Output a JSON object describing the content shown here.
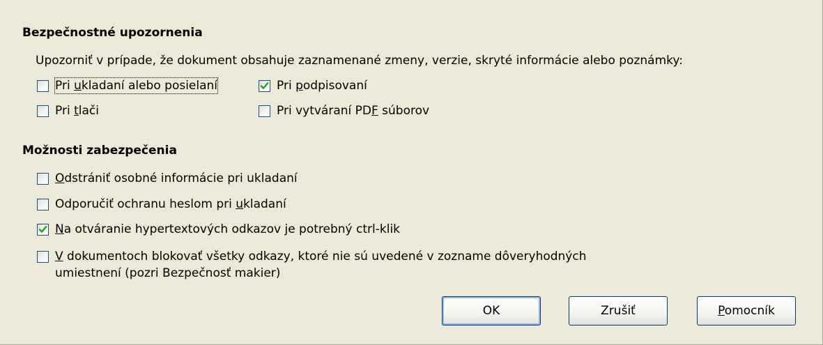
{
  "security_warnings": {
    "title": "Bezpečnostné upozornenia",
    "description": "Upozorniť v prípade, že dokument obsahuje zaznamenané zmeny, verzie, skryté informácie alebo poznámky:",
    "options": [
      {
        "pre": "Pri ",
        "key": "u",
        "post": "kladaní alebo posielaní",
        "checked": false
      },
      {
        "pre": "Pri ",
        "key": "p",
        "post": "odpisovaní",
        "checked": true
      },
      {
        "pre": "Pri ",
        "key": "t",
        "post": "lači",
        "checked": false
      },
      {
        "pre": "Pri vytváraní PD",
        "key": "F",
        "post": " súborov",
        "checked": false
      }
    ]
  },
  "security_options": {
    "title": "Možnosti zabezpečenia",
    "options": [
      {
        "pre": "",
        "key": "O",
        "post": "dstrániť osobné informácie pri ukladaní",
        "checked": false
      },
      {
        "pre": "Odporučiť ochranu heslom pri ",
        "key": "u",
        "post": "kladaní",
        "checked": false
      },
      {
        "pre": "",
        "key": "N",
        "post": "a otváranie hypertextových odkazov je potrebný ctrl-klik",
        "checked": true
      },
      {
        "pre": "",
        "key": "V",
        "post": " dokumentoch blokovať všetky odkazy, ktoré nie sú uvedené v zozname dôveryhodných",
        "line2": "umiestnení (pozri Bezpečnosť makier)",
        "checked": false
      }
    ]
  },
  "buttons": {
    "ok": {
      "pre": "OK",
      "key": "",
      "post": ""
    },
    "cancel": {
      "pre": "Zrušiť",
      "key": "",
      "post": ""
    },
    "help": {
      "pre": "",
      "key": "P",
      "post": "omocník"
    }
  },
  "colors": {
    "dialog_bg": "#ece9d8",
    "checkbox_border": "#1c5180",
    "checkmark": "#21a121",
    "button_border": "#003c74"
  }
}
